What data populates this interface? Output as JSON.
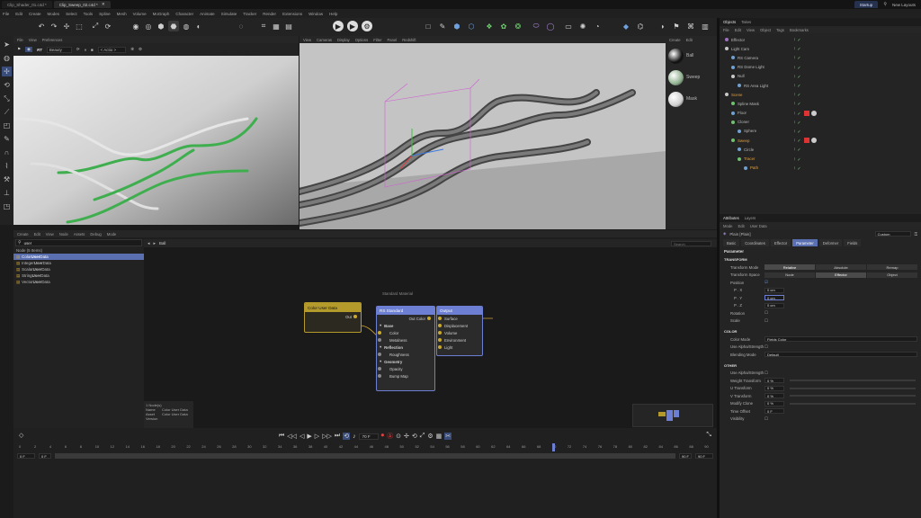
{
  "tabs": {
    "file1": "Clip_Shader_01.c4d *",
    "file2": "Clip_Sweep_02.c4d *",
    "layout": "Startup",
    "new_layouts": "New Layouts"
  },
  "menu": [
    "File",
    "Edit",
    "Create",
    "Modes",
    "Select",
    "Tools",
    "Spline",
    "Mesh",
    "Volume",
    "MoGraph",
    "Character",
    "Animate",
    "Simulate",
    "Tracker",
    "Render",
    "Extensions",
    "Window",
    "Help"
  ],
  "left_viewport": {
    "menu": [
      "File",
      "View",
      "Preferences"
    ],
    "render_preset": "Beauty",
    "actions": "< Actio >",
    "rt": "RT"
  },
  "right_viewport": {
    "menu": [
      "View",
      "Cameras",
      "Display",
      "Options",
      "Filter",
      "Panel",
      "Redshift"
    ]
  },
  "material_panel": {
    "menu": [
      "Create",
      "Edit"
    ],
    "materials": [
      "Ball",
      "Sweep",
      "Mask"
    ]
  },
  "node_editor": {
    "menu": [
      "Create",
      "Edit",
      "View",
      "Node",
      "Assets",
      "Debug",
      "Mode"
    ],
    "search": "user",
    "results_header": "Node (5 Items)",
    "results": [
      {
        "pre": "Color ",
        "bold": "User",
        "post": " Data"
      },
      {
        "pre": "Integer ",
        "bold": "User",
        "post": " Data"
      },
      {
        "pre": "Scalar ",
        "bold": "User",
        "post": " Data"
      },
      {
        "pre": "String ",
        "bold": "User",
        "post": " Data"
      },
      {
        "pre": "Vector ",
        "bold": "User",
        "post": " Data"
      }
    ],
    "breadcrumb": "Ball",
    "search_placeholder": "Search",
    "nodes": {
      "color_user_data": {
        "title": "Color User Data",
        "out": "Out"
      },
      "rs_standard": {
        "subtitle": "Standard Material",
        "title": "RS Standard",
        "out": "Out Color",
        "groups": [
          {
            "label": "Base",
            "ports": [
              "Color",
              "Metalness"
            ]
          },
          {
            "label": "Reflection",
            "ports": [
              "Roughness"
            ]
          },
          {
            "label": "Geometry",
            "ports": [
              "Opacity",
              "Bump Map"
            ]
          }
        ]
      },
      "output": {
        "title": "Output",
        "ports": [
          "Surface",
          "Displacement",
          "Volume",
          "Environment",
          "Light"
        ]
      }
    },
    "info": {
      "count": "1 Node(s)",
      "name_label": "Name",
      "name_value": "Color User Data",
      "asset_label": "Asset",
      "asset_value": "Color User Data",
      "version_label": "Version",
      "version_value": ""
    }
  },
  "objects": {
    "tabs": [
      "Objects",
      "Takes"
    ],
    "menu": [
      "File",
      "Edit",
      "View",
      "Object",
      "Tags",
      "Bookmarks"
    ],
    "items": [
      {
        "name": "Effector",
        "indent": 0,
        "color": "#b8b8b8",
        "dot": "#a070c0"
      },
      {
        "name": "Light Cam",
        "indent": 0,
        "color": "#b8b8b8",
        "dot": "#c8c8c8"
      },
      {
        "name": "RS Camera",
        "indent": 1,
        "color": "#b8b8b8",
        "dot": "#70a0d0"
      },
      {
        "name": "RS Dome Light",
        "indent": 1,
        "color": "#b8b8b8",
        "dot": "#70a0d0"
      },
      {
        "name": "Null",
        "indent": 1,
        "color": "#b8b8b8",
        "dot": "#c8c8c8"
      },
      {
        "name": "RS Area Light",
        "indent": 2,
        "color": "#b8b8b8",
        "dot": "#70a0d0"
      },
      {
        "name": "Scene",
        "indent": 0,
        "color": "#e0a040",
        "dot": "#c8c8c8"
      },
      {
        "name": "Spline Mask",
        "indent": 1,
        "color": "#b8b8b8",
        "dot": "#70c070"
      },
      {
        "name": "Floor",
        "indent": 1,
        "color": "#b8b8b8",
        "dot": "#70a0d0"
      },
      {
        "name": "Cloner",
        "indent": 1,
        "color": "#b8b8b8",
        "dot": "#70c070"
      },
      {
        "name": "Sphere",
        "indent": 2,
        "color": "#b8b8b8",
        "dot": "#70a0d0"
      },
      {
        "name": "Sweep",
        "indent": 1,
        "color": "#e0a040",
        "dot": "#70c070"
      },
      {
        "name": "Circle",
        "indent": 2,
        "color": "#b8b8b8",
        "dot": "#70a0d0"
      },
      {
        "name": "Tracer",
        "indent": 2,
        "color": "#e0a040",
        "dot": "#70c070"
      },
      {
        "name": "Path",
        "indent": 3,
        "color": "#e0a040",
        "dot": "#70a0d0"
      }
    ]
  },
  "attributes": {
    "tabs": [
      "Attributes",
      "Layers"
    ],
    "menu": [
      "Mode",
      "Edit",
      "User Data"
    ],
    "object": "Plain [Plain]",
    "preset": "Custom",
    "section_tabs": [
      "Basic",
      "Coordinates",
      "Effector",
      "Parameter",
      "Deformer",
      "Fields"
    ],
    "active_tab": "Parameter",
    "heading": "Parameter",
    "transform": {
      "title": "TRANSFORM",
      "mode_label": "Transform Mode",
      "mode_options": [
        "Relative",
        "Absolute",
        "Remap"
      ],
      "space_label": "Transform Space",
      "space_options": [
        "Node",
        "Effector",
        "Object"
      ],
      "position_label": "Position",
      "px_label": "P . X",
      "px": "0 cm",
      "py_label": "P . Y",
      "py": "0 cm",
      "pz_label": "P . Z",
      "pz": "0 cm",
      "rotation_label": "Rotation",
      "scale_label": "Scale"
    },
    "color": {
      "title": "COLOR",
      "mode_label": "Color Mode",
      "mode_value": "Fields Color",
      "alpha_label": "Use Alpha/Strength",
      "blend_label": "Blending Mode",
      "blend_value": "Default"
    },
    "other": {
      "title": "OTHER",
      "alpha_label": "Use Alpha/Strength",
      "rows": [
        {
          "label": "Weight Transform",
          "value": "0 %"
        },
        {
          "label": "U Transform",
          "value": "0 %"
        },
        {
          "label": "V Transform",
          "value": "0 %"
        },
        {
          "label": "Modify Clone",
          "value": "0 %"
        },
        {
          "label": "Time Offset",
          "value": "0 F"
        }
      ],
      "visibility_label": "Visibility"
    }
  },
  "timeline": {
    "ticks": [
      "0",
      "2",
      "4",
      "6",
      "8",
      "10",
      "12",
      "14",
      "16",
      "18",
      "20",
      "22",
      "24",
      "26",
      "28",
      "30",
      "32",
      "34",
      "36",
      "38",
      "40",
      "42",
      "44",
      "46",
      "48",
      "50",
      "52",
      "54",
      "56",
      "58",
      "60",
      "62",
      "64",
      "66",
      "68",
      "70",
      "72",
      "74",
      "76",
      "78",
      "80",
      "82",
      "84",
      "86",
      "88",
      "90"
    ],
    "current_frame": "70 F",
    "start": "0 F",
    "start2": "0 F",
    "end": "90 F",
    "end2": "90 F",
    "playhead_fraction": 0.778
  },
  "colors": {
    "accent": "#5a6fb0",
    "node_yellow": "#b49a2a",
    "node_blue": "#6d7fd2",
    "object_orange": "#e0a040"
  }
}
